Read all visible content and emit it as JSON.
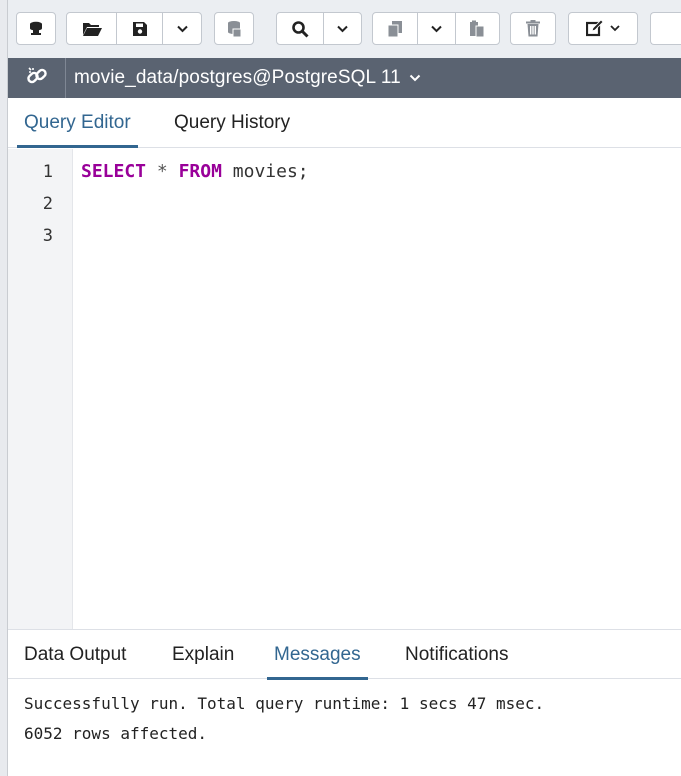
{
  "toolbar": {
    "buttons": [
      {
        "name": "connect-icon"
      },
      {
        "name": "open-file-icon"
      },
      {
        "name": "save-icon"
      },
      {
        "name": "save-dropdown-icon"
      },
      {
        "name": "database-icon"
      },
      {
        "name": "find-icon"
      },
      {
        "name": "find-dropdown-icon"
      },
      {
        "name": "copy-icon"
      },
      {
        "name": "copy-dropdown-icon"
      },
      {
        "name": "paste-icon"
      },
      {
        "name": "delete-icon"
      },
      {
        "name": "edit-icon"
      }
    ]
  },
  "connection": {
    "title": "movie_data/postgres@PostgreSQL 11",
    "icon": "link-icon"
  },
  "editor_tabs": {
    "query_editor": "Query Editor",
    "query_history": "Query History",
    "active": "query_editor"
  },
  "editor": {
    "line_numbers": [
      "1",
      "2",
      "3"
    ],
    "line1": {
      "kw1": "SELECT",
      "op": "*",
      "kw2": "FROM",
      "rest": "movies;"
    }
  },
  "output_tabs": {
    "data_output": "Data Output",
    "explain": "Explain",
    "messages": "Messages",
    "notifications": "Notifications",
    "active": "messages"
  },
  "messages": {
    "line1": "Successfully run. Total query runtime: 1 secs 47 msec.",
    "line2": "6052 rows affected."
  },
  "colors": {
    "accent": "#326690",
    "connection_bar": "#5a6371",
    "keyword": "#990099"
  }
}
